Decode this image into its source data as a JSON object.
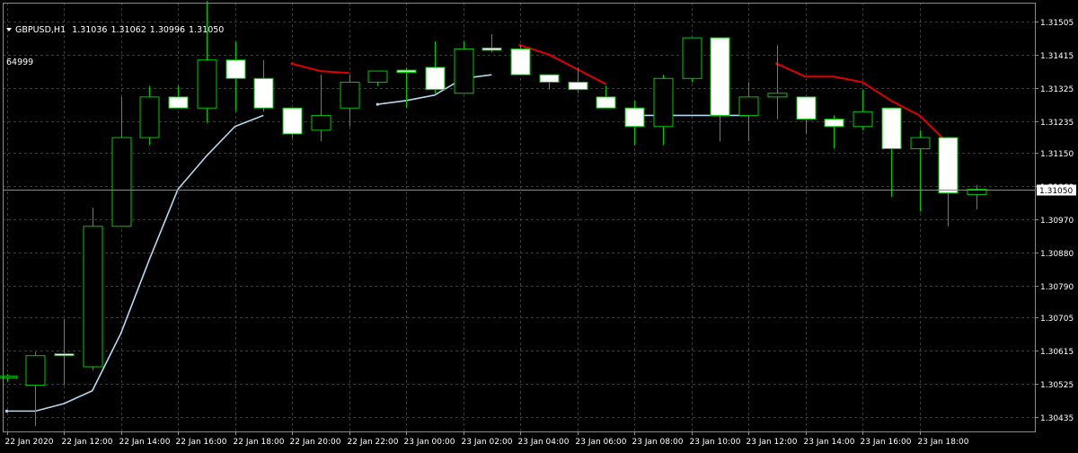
{
  "header": {
    "symbol_timeframe": "GBPUSD,H1",
    "open": "1.31036",
    "high": "1.31062",
    "low": "1.30996",
    "close": "1.31050",
    "extra": "64999"
  },
  "colors": {
    "background": "#000000",
    "grid": "#3a3a3a",
    "candle_outline": "#00c800",
    "candle_up_fill": "#000000",
    "candle_down_fill": "#ffffff",
    "ma_light": "#b4d8f0",
    "ma_red": "#e00000",
    "axis_text": "#ffffff",
    "price_label_bg": "#ffffff",
    "price_label_text": "#000000"
  },
  "chart_data": {
    "type": "candlestick",
    "symbol": "GBPUSD",
    "timeframe": "H1",
    "current_price": "1.31050",
    "y_ticks": [
      "1.31505",
      "1.31415",
      "1.31325",
      "1.31235",
      "1.31150",
      "1.31060",
      "1.30970",
      "1.30880",
      "1.30790",
      "1.30705",
      "1.30615",
      "1.30525",
      "1.30435"
    ],
    "ylim": [
      1.30395,
      1.31555
    ],
    "x_tick_labels": [
      "22 Jan 2020",
      "22 Jan 12:00",
      "22 Jan 14:00",
      "22 Jan 16:00",
      "22 Jan 18:00",
      "22 Jan 20:00",
      "22 Jan 22:00",
      "23 Jan 00:00",
      "23 Jan 02:00",
      "23 Jan 04:00",
      "23 Jan 06:00",
      "23 Jan 08:00",
      "23 Jan 10:00",
      "23 Jan 12:00",
      "23 Jan 14:00",
      "23 Jan 16:00",
      "23 Jan 18:00"
    ],
    "candles": [
      [
        1.3054,
        1.3055,
        1.3053,
        1.30545
      ],
      [
        1.3052,
        1.3061,
        1.3041,
        1.306
      ],
      [
        1.30605,
        1.307,
        1.3052,
        1.306
      ],
      [
        1.3057,
        1.31,
        1.3056,
        1.3095
      ],
      [
        1.3095,
        1.313,
        1.3095,
        1.3119
      ],
      [
        1.3119,
        1.3133,
        1.3117,
        1.313
      ],
      [
        1.313,
        1.3133,
        1.3127,
        1.3127
      ],
      [
        1.3127,
        1.3156,
        1.3123,
        1.314
      ],
      [
        1.314,
        1.3145,
        1.3126,
        1.3135
      ],
      [
        1.3135,
        1.314,
        1.3126,
        1.3127
      ],
      [
        1.3127,
        1.3127,
        1.3119,
        1.312
      ],
      [
        1.3121,
        1.3136,
        1.3118,
        1.3125
      ],
      [
        1.3127,
        1.3136,
        1.3122,
        1.3134
      ],
      [
        1.3134,
        1.3137,
        1.3133,
        1.3137
      ],
      [
        1.3137,
        1.3138,
        1.3127,
        1.3137
      ],
      [
        1.3138,
        1.3145,
        1.3131,
        1.3132
      ],
      [
        1.3131,
        1.3145,
        1.3131,
        1.3143
      ],
      [
        1.3143,
        1.3147,
        1.3142,
        1.3143
      ],
      [
        1.3143,
        1.3144,
        1.3137,
        1.3136
      ],
      [
        1.3136,
        1.3136,
        1.3132,
        1.3134
      ],
      [
        1.3134,
        1.3138,
        1.3131,
        1.3132
      ],
      [
        1.313,
        1.3133,
        1.3127,
        1.3127
      ],
      [
        1.3127,
        1.3129,
        1.3117,
        1.3122
      ],
      [
        1.3122,
        1.3136,
        1.3117,
        1.3135
      ],
      [
        1.3135,
        1.3146,
        1.3134,
        1.3146
      ],
      [
        1.3146,
        1.3146,
        1.3118,
        1.3125
      ],
      [
        1.3125,
        1.3134,
        1.3118,
        1.313
      ],
      [
        1.313,
        1.3144,
        1.3124,
        1.3131
      ],
      [
        1.313,
        1.313,
        1.312,
        1.3124
      ],
      [
        1.3124,
        1.3125,
        1.3116,
        1.3122
      ],
      [
        1.3122,
        1.3132,
        1.3121,
        1.3126
      ],
      [
        1.3127,
        1.3127,
        1.3103,
        1.3116
      ],
      [
        1.3116,
        1.3121,
        1.3099,
        1.3119
      ],
      [
        1.3119,
        1.3119,
        1.3095,
        1.3104
      ],
      [
        1.31036,
        1.31062,
        1.30996,
        1.3105
      ]
    ],
    "ma_light": [
      [
        0,
        1.3045
      ],
      [
        1,
        1.3045
      ],
      [
        2,
        1.3047
      ],
      [
        3,
        1.30505
      ],
      [
        4,
        1.3066
      ],
      [
        5,
        1.3086
      ],
      [
        6,
        1.3105
      ],
      [
        7,
        1.3114
      ],
      [
        8,
        1.3122
      ],
      [
        9,
        1.3125
      ],
      null,
      [
        13,
        1.3128
      ],
      [
        14,
        1.3129
      ],
      [
        15,
        1.31305
      ],
      [
        16,
        1.3135
      ],
      [
        17,
        1.3136
      ],
      null,
      [
        22,
        1.3125
      ],
      [
        23,
        1.3125
      ],
      [
        24,
        1.3125
      ],
      [
        25,
        1.3125
      ],
      [
        26,
        1.3125
      ]
    ],
    "ma_red": [
      [
        10,
        1.3139
      ],
      [
        11,
        1.3137
      ],
      [
        12,
        1.31365
      ],
      null,
      [
        18,
        1.3144
      ],
      [
        19,
        1.31415
      ],
      [
        20,
        1.31375
      ],
      [
        21,
        1.31335
      ],
      null,
      [
        27,
        1.3139
      ],
      [
        28,
        1.31355
      ],
      [
        29,
        1.31355
      ],
      [
        30,
        1.3134
      ],
      [
        31,
        1.3129
      ],
      [
        32,
        1.3125
      ],
      [
        33,
        1.31175
      ]
    ]
  }
}
